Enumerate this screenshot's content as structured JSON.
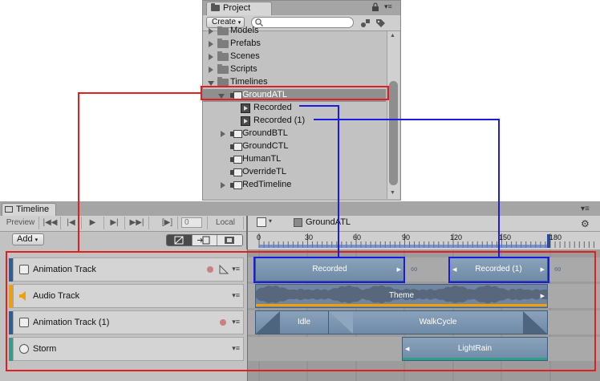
{
  "project": {
    "tab_title": "Project",
    "create_label": "Create",
    "tree": [
      {
        "label": "Models",
        "kind": "folder",
        "indent": 0,
        "expanded": false
      },
      {
        "label": "Prefabs",
        "kind": "folder",
        "indent": 0,
        "expanded": false
      },
      {
        "label": "Scenes",
        "kind": "folder",
        "indent": 0,
        "expanded": false
      },
      {
        "label": "Scripts",
        "kind": "folder",
        "indent": 0,
        "expanded": false
      },
      {
        "label": "Timelines",
        "kind": "folder",
        "indent": 0,
        "expanded": true
      },
      {
        "label": "GroundATL",
        "kind": "timeline",
        "indent": 1,
        "expanded": true,
        "selected": true
      },
      {
        "label": "Recorded",
        "kind": "clip",
        "indent": 2
      },
      {
        "label": "Recorded (1)",
        "kind": "clip",
        "indent": 2
      },
      {
        "label": "GroundBTL",
        "kind": "timeline",
        "indent": 1,
        "expanded": false
      },
      {
        "label": "GroundCTL",
        "kind": "timeline",
        "indent": 1
      },
      {
        "label": "HumanTL",
        "kind": "timeline",
        "indent": 1
      },
      {
        "label": "OverrideTL",
        "kind": "timeline",
        "indent": 1
      },
      {
        "label": "RedTimeline",
        "kind": "timeline",
        "indent": 1,
        "expanded": false
      }
    ]
  },
  "timeline": {
    "tab_title": "Timeline",
    "preview_label": "Preview",
    "frame_value": "0",
    "local_label": "Local",
    "asset_name": "GroundATL",
    "add_label": "Add",
    "ruler_ticks": [
      "0",
      "30",
      "60",
      "90",
      "120",
      "150",
      "180"
    ],
    "tracks": [
      {
        "name": "Animation Track",
        "color": "#2b5e9a",
        "icon": "animator-icon"
      },
      {
        "name": "Audio Track",
        "color": "#f0a000",
        "icon": "speaker-icon"
      },
      {
        "name": "Animation Track (1)",
        "color": "#2b5e9a",
        "icon": "animator-icon"
      },
      {
        "name": "Storm",
        "color": "#2f9e8a",
        "icon": "particle-icon"
      }
    ],
    "clips": {
      "recorded": "Recorded",
      "recorded1": "Recorded (1)",
      "theme": "Theme",
      "idle": "Idle",
      "walkcycle": "WalkCycle",
      "lightrain": "LightRain"
    }
  },
  "annotation_colors": {
    "red": "#e02020",
    "blue": "#1c1ce0"
  }
}
